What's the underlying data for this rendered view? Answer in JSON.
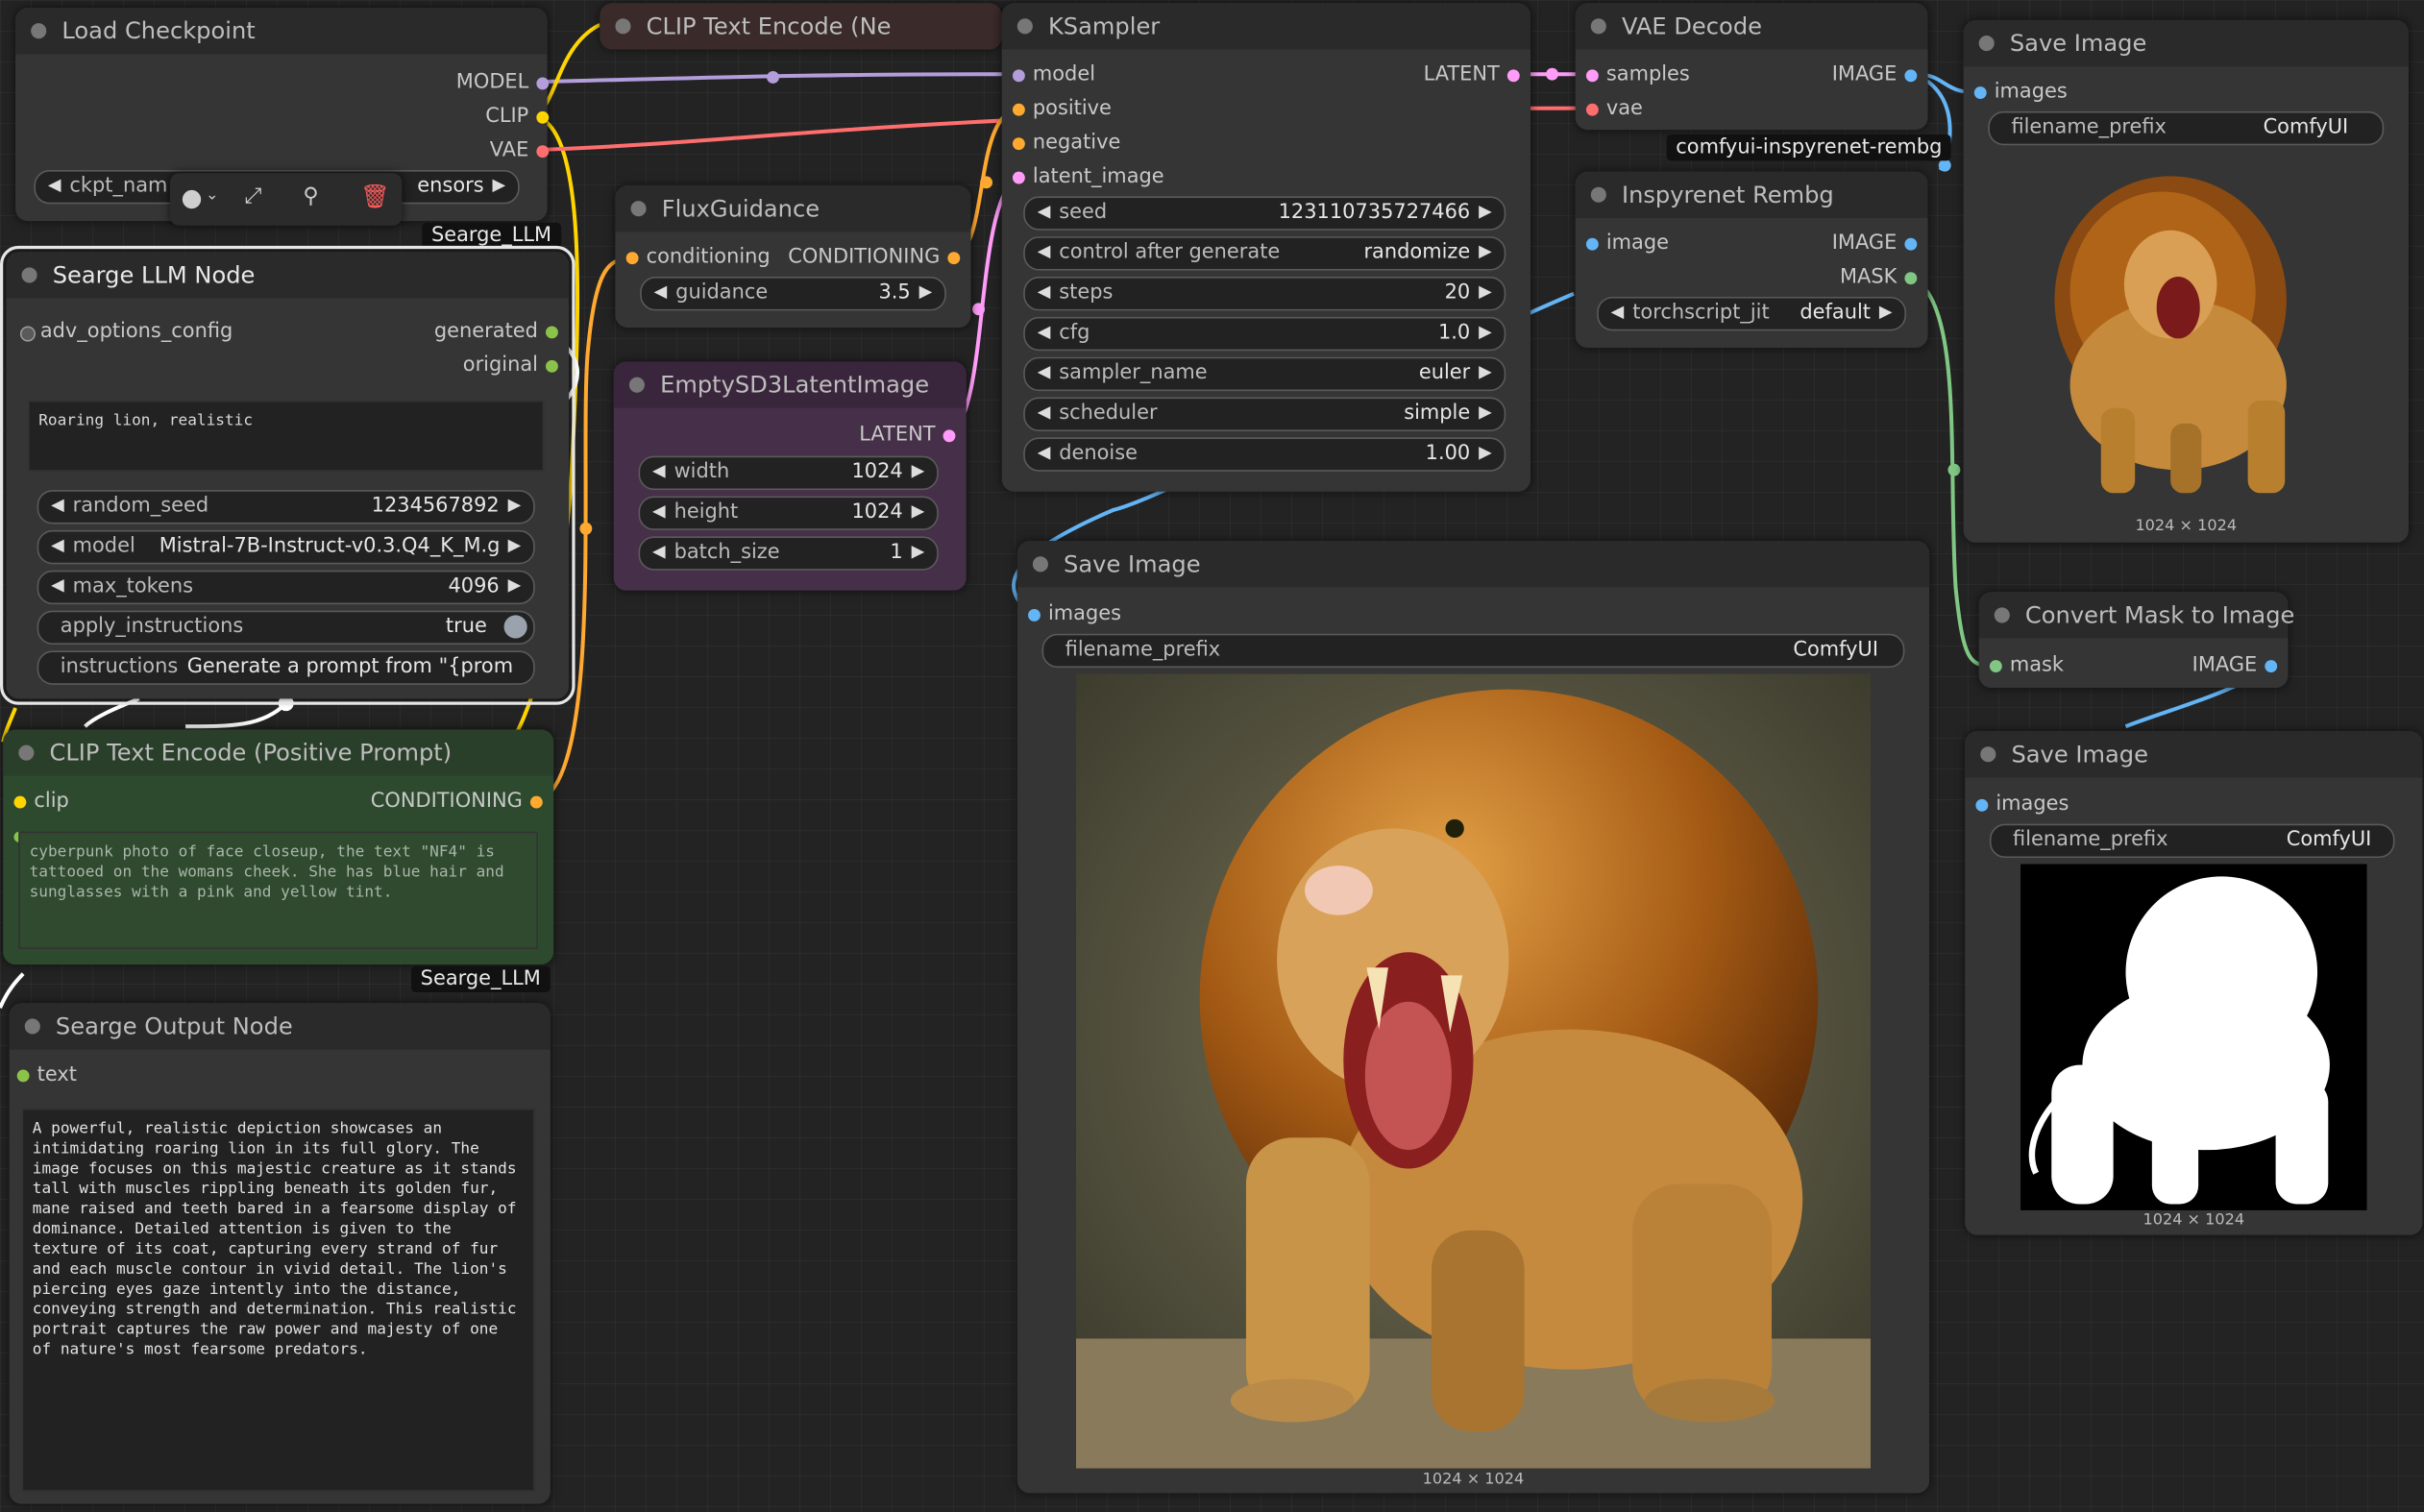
{
  "colors": {
    "canvas": "#232323",
    "node_bg": "#353535",
    "node_header": "#2a2a2a",
    "model": "#b39ddb",
    "clip": "#ffd500",
    "vae": "#ff6e6e",
    "conditioning": "#ffa931",
    "latent": "#ff9cf9",
    "image": "#64b5f6",
    "mask": "#81c784",
    "string": "#8bc34a",
    "positive_node": "#2e4a2e",
    "latent_node": "#462f48"
  },
  "load_checkpoint": {
    "title": "Load Checkpoint",
    "outputs": [
      "MODEL",
      "CLIP",
      "VAE"
    ],
    "ckpt_left": "ckpt_nam",
    "ckpt_right": "ensors",
    "badge": "Searge_LLM"
  },
  "clip_neg": {
    "title": "CLIP Text Encode (Ne"
  },
  "ksampler": {
    "title": "KSampler",
    "inputs": [
      "model",
      "positive",
      "negative",
      "latent_image"
    ],
    "output": "LATENT",
    "widgets": [
      {
        "name": "seed",
        "value": "123110735727466"
      },
      {
        "name": "control after generate",
        "value": "randomize"
      },
      {
        "name": "steps",
        "value": "20"
      },
      {
        "name": "cfg",
        "value": "1.0"
      },
      {
        "name": "sampler_name",
        "value": "euler"
      },
      {
        "name": "scheduler",
        "value": "simple"
      },
      {
        "name": "denoise",
        "value": "1.00"
      }
    ]
  },
  "vae_decode": {
    "title": "VAE Decode",
    "inputs": [
      "samples",
      "vae"
    ],
    "output": "IMAGE",
    "badge": "comfyui-inspyrenet-rembg"
  },
  "inspyrenet": {
    "title": "Inspyrenet Rembg",
    "input": "image",
    "outputs": [
      "IMAGE",
      "MASK"
    ],
    "widget": {
      "name": "torchscript_jit",
      "value": "default"
    }
  },
  "save_image_1": {
    "title": "Save Image",
    "input": "images",
    "widget": {
      "name": "filename_prefix",
      "value": "ComfyUI"
    },
    "caption": "1024 × 1024"
  },
  "flux_guidance": {
    "title": "FluxGuidance",
    "input": "conditioning",
    "output": "CONDITIONING",
    "widget": {
      "name": "guidance",
      "value": "3.5"
    }
  },
  "empty_latent": {
    "title": "EmptySD3LatentImage",
    "output": "LATENT",
    "widgets": [
      {
        "name": "width",
        "value": "1024"
      },
      {
        "name": "height",
        "value": "1024"
      },
      {
        "name": "batch_size",
        "value": "1"
      }
    ]
  },
  "searge_llm": {
    "title": "Searge LLM Node",
    "input": "adv_options_config",
    "outputs": [
      "generated",
      "original"
    ],
    "prompt": "Roaring lion, realistic",
    "widgets": [
      {
        "name": "random_seed",
        "value": "1234567892"
      },
      {
        "name": "model",
        "value": "Mistral-7B-Instruct-v0.3.Q4_K_M.g..."
      },
      {
        "name": "max_tokens",
        "value": "4096"
      },
      {
        "name": "apply_instructions",
        "value": "true"
      },
      {
        "name": "instructions",
        "value": "Generate a prompt from \"{promp"
      }
    ]
  },
  "clip_pos": {
    "title": "CLIP Text Encode (Positive Prompt)",
    "input": "clip",
    "output": "CONDITIONING",
    "text": "cyberpunk photo of face closeup, the text \"NF4\" is tattooed on the womans cheek. She has blue hair and sunglasses with a pink and yellow tint.",
    "badge": "Searge_LLM"
  },
  "searge_output": {
    "title": "Searge Output Node",
    "input": "text",
    "text": "A powerful, realistic depiction showcases an intimidating roaring lion in its full glory. The image focuses on this majestic creature as it stands tall with muscles rippling beneath its golden fur, mane raised and teeth bared in a fearsome display of dominance. Detailed attention is given to the texture of its coat, capturing every strand of fur and each muscle contour in vivid detail. The lion's piercing eyes gaze intently into the distance, conveying strength and determination. This realistic portrait captures the raw power and majesty of one of nature's most fearsome predators."
  },
  "save_image_main": {
    "title": "Save Image",
    "input": "images",
    "widget": {
      "name": "filename_prefix",
      "value": "ComfyUI"
    },
    "caption": "1024 × 1024"
  },
  "convert_mask": {
    "title": "Convert Mask to Image",
    "input": "mask",
    "output": "IMAGE"
  },
  "save_image_mask": {
    "title": "Save Image",
    "input": "images",
    "widget": {
      "name": "filename_prefix",
      "value": "ComfyUI"
    },
    "caption": "1024 × 1024"
  },
  "node_toolbar": {
    "icons": [
      "color-icon",
      "bypass-icon",
      "pin-icon",
      "delete-icon"
    ]
  }
}
